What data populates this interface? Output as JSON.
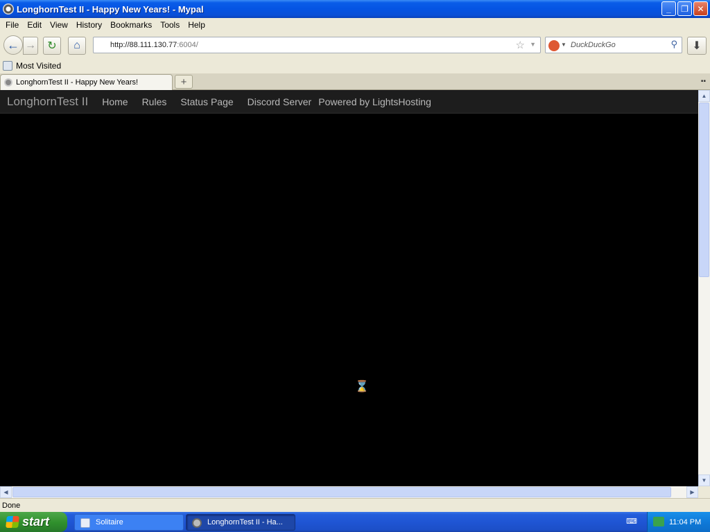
{
  "window": {
    "title": "LonghornTest II - Happy New Years! - Mypal",
    "minimize": "_",
    "maximize": "❐",
    "close": "✕"
  },
  "menu": [
    "File",
    "Edit",
    "View",
    "History",
    "Bookmarks",
    "Tools",
    "Help"
  ],
  "nav": {
    "url_host": "http://88.111.130.77",
    "url_port": ":6004/",
    "search_placeholder": "DuckDuckGo"
  },
  "bookmarks": {
    "most_visited": "Most Visited"
  },
  "tab": {
    "title": "LonghornTest II - Happy New Years!",
    "new_tab": "+"
  },
  "site": {
    "brand": "LonghornTest II",
    "links": [
      "Home",
      "Rules",
      "Status Page",
      "Discord Server"
    ],
    "powered": "Powered by LightsHosting"
  },
  "status": {
    "text": "Done"
  },
  "taskbar": {
    "start": "start",
    "items": [
      "Solitaire",
      "LonghornTest II - Ha..."
    ],
    "clock": "11:04 PM"
  }
}
